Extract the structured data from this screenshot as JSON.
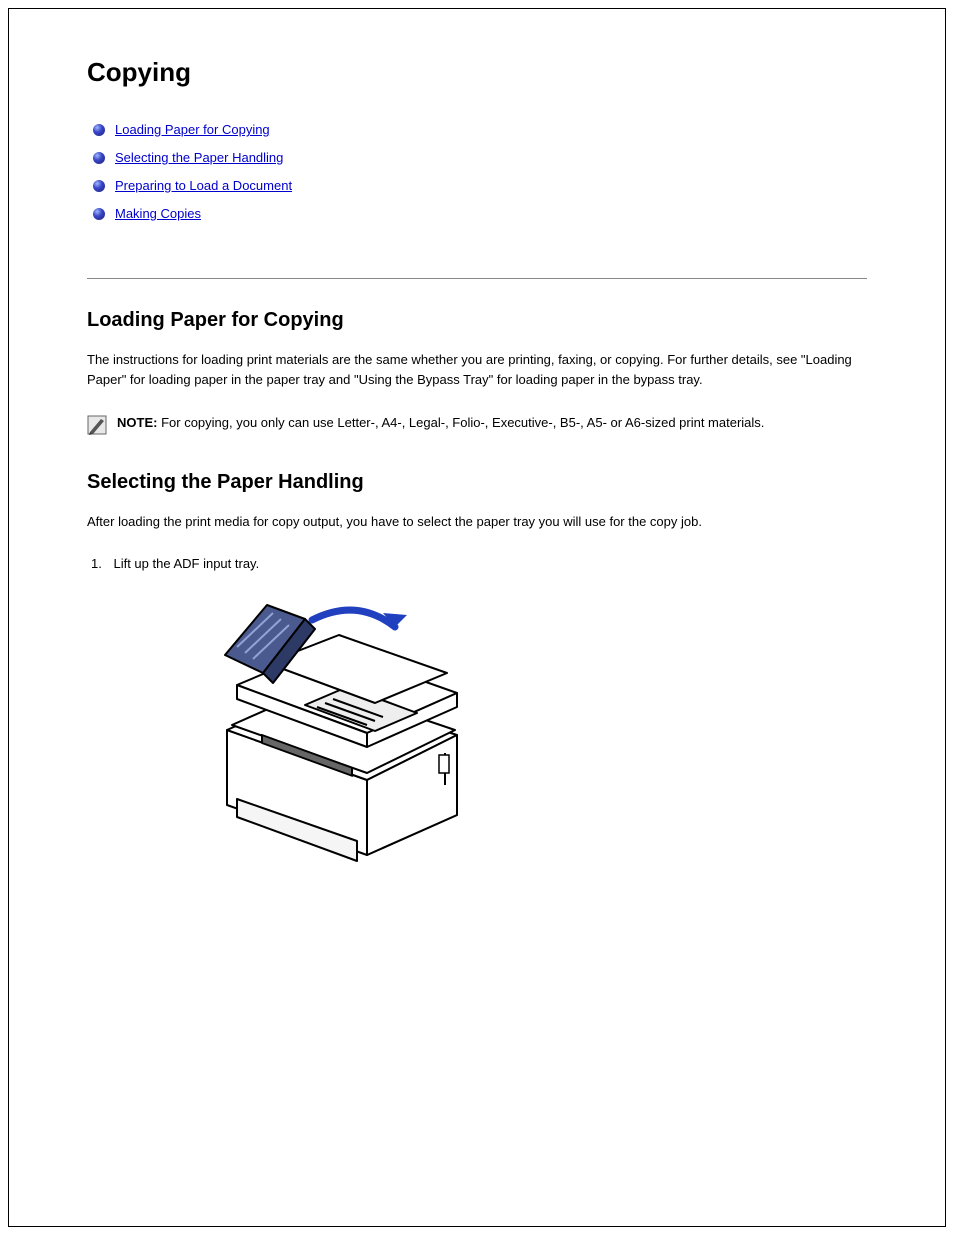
{
  "title": "Copying",
  "toc": [
    {
      "label": "Loading Paper for Copying",
      "href": "#loading-paper"
    },
    {
      "label": "Selecting the Paper Handling",
      "href": "#paper-handling"
    },
    {
      "label": "Preparing to Load a Document",
      "href": "#prepare-load"
    },
    {
      "label": "Making Copies",
      "href": "#making-copies"
    }
  ],
  "section1": {
    "heading": "Loading Paper for Copying",
    "p1": "The instructions for loading print materials are the same whether you are printing, faxing, or copying. For further details, see \"Loading Paper\" for loading paper in the paper tray and \"Using the Bypass Tray\" for loading paper in the bypass tray.",
    "note": "For copying, you only can use Letter-, A4-, Legal-, Folio-, Executive-, B5-, A5- or A6-sized print materials."
  },
  "section2": {
    "heading": "Selecting the Paper Handling",
    "p1": "After loading the print media for copy output, you have to select the paper tray you will use for the copy job.",
    "step1_num": "1.",
    "step1_text": "Lift up the ADF input tray."
  }
}
